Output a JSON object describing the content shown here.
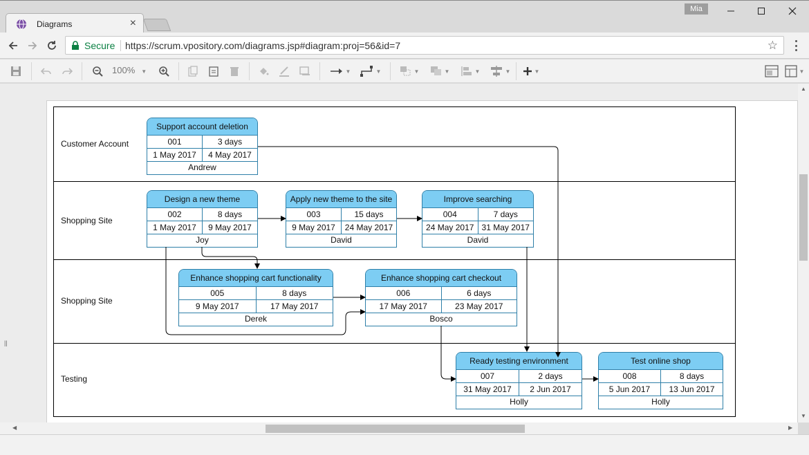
{
  "browser": {
    "tab_title": "Diagrams",
    "tab_close": "×",
    "user_badge": "Mia",
    "secure_label": "Secure",
    "url": "https://scrum.vpository.com/diagrams.jsp#diagram:proj=56&id=7",
    "star": "☆"
  },
  "toolbar": {
    "zoom": "100%"
  },
  "lanes": [
    {
      "label": "Customer Account"
    },
    {
      "label": "Shopping Site"
    },
    {
      "label": "Shopping Site"
    },
    {
      "label": "Testing"
    }
  ],
  "tasks": [
    {
      "title": "Support account deletion",
      "id": "001",
      "duration": "3 days",
      "start": "1 May 2017",
      "end": "4 May 2017",
      "owner": "Andrew"
    },
    {
      "title": "Design a new theme",
      "id": "002",
      "duration": "8 days",
      "start": "1 May 2017",
      "end": "9 May 2017",
      "owner": "Joy"
    },
    {
      "title": "Apply new theme to the site",
      "id": "003",
      "duration": "15 days",
      "start": "9 May 2017",
      "end": "24 May 2017",
      "owner": "David"
    },
    {
      "title": "Improve searching",
      "id": "004",
      "duration": "7 days",
      "start": "24 May 2017",
      "end": "31 May 2017",
      "owner": "David"
    },
    {
      "title": "Enhance shopping cart functionality",
      "id": "005",
      "duration": "8 days",
      "start": "9 May 2017",
      "end": "17 May 2017",
      "owner": "Derek"
    },
    {
      "title": "Enhance shopping cart checkout",
      "id": "006",
      "duration": "6 days",
      "start": "17 May 2017",
      "end": "23 May 2017",
      "owner": "Bosco"
    },
    {
      "title": "Ready testing environment",
      "id": "007",
      "duration": "2 days",
      "start": "31 May 2017",
      "end": "2 Jun 2017",
      "owner": "Holly"
    },
    {
      "title": "Test online shop",
      "id": "008",
      "duration": "8 days",
      "start": "5 Jun 2017",
      "end": "13 Jun 2017",
      "owner": "Holly"
    }
  ],
  "colors": {
    "task_header": "#7dcdf3",
    "task_border": "#2e7fa8",
    "secure_green": "#0b8043"
  },
  "icons": {
    "save": "save-icon",
    "undo": "undo-icon",
    "redo": "redo-icon",
    "zoom_out": "zoom-out-icon",
    "zoom_in": "zoom-in-icon",
    "copy": "copy-icon",
    "paste": "paste-icon",
    "delete": "trash-icon",
    "fill": "fill-color-icon",
    "line": "line-color-icon",
    "shadow": "shadow-icon",
    "connector": "connector-arrow-icon",
    "waypoint": "waypoint-icon",
    "add": "plus-icon"
  }
}
